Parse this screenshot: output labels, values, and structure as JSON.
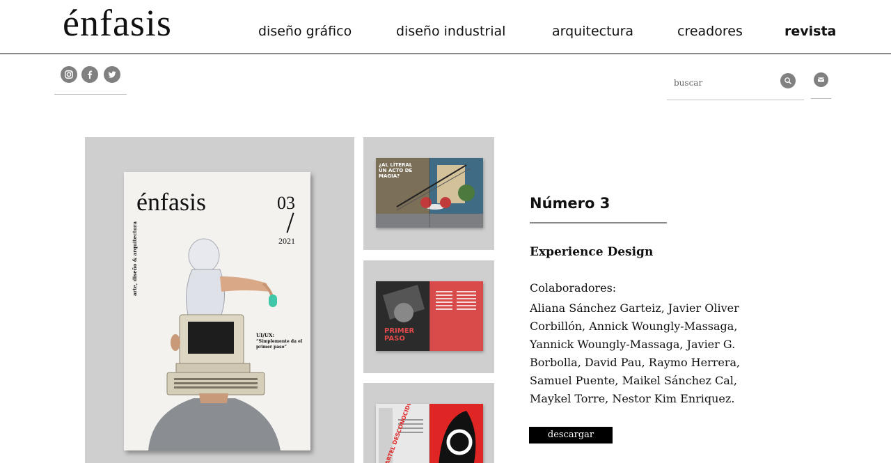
{
  "brand": {
    "logo": "énfasis"
  },
  "nav": {
    "items": [
      {
        "label": "diseño gráfico"
      },
      {
        "label": "diseño industrial"
      },
      {
        "label": "arquitectura"
      },
      {
        "label": "creadores"
      },
      {
        "label": "revista",
        "active": true
      }
    ]
  },
  "social": {
    "icons": [
      "instagram-icon",
      "facebook-icon",
      "twitter-icon"
    ]
  },
  "search": {
    "placeholder": "buscar",
    "icon": "search-icon"
  },
  "mail": {
    "icon": "mail-icon"
  },
  "cover": {
    "logo": "énfasis",
    "number": "03",
    "year": "2021",
    "side_text": "arte, diseño & arquitectura",
    "uiux": "UI/UX:",
    "quote": "“Simplemente da el primer paso”"
  },
  "thumbs": [
    {
      "headline": "¿AL LÍTERAL UN ACTO DE MAGIA?"
    },
    {
      "headline": "PRIMER PASO"
    },
    {
      "headline": "CARTEL DESCONOCIDO"
    }
  ],
  "issue": {
    "title": "Número 3",
    "subtitle": "Experience Design",
    "collab_label": "Colaboradores:",
    "collaborators": "Aliana Sánchez Garteiz, Javier Oliver Corbillón, Annick Woungly-Massaga, Yannick Woungly-Massaga, Javier G. Borbolla, David Pau, Raymo Herrera, Samuel Puente, Maikel Sánchez Cal, Maykel Torre, Nestor Kim Enriquez.",
    "download_label": "descargar"
  },
  "colors": {
    "icon_gray": "#808080",
    "panel_gray": "#cfcfcf",
    "rule_gray": "#8a8a8a"
  }
}
